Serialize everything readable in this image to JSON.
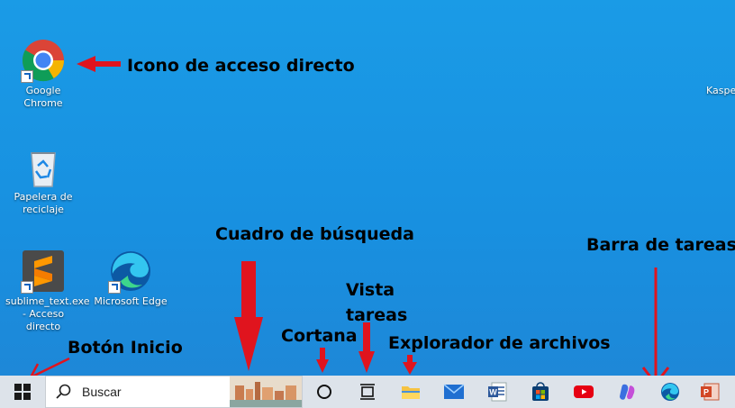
{
  "desktop": {
    "icons": [
      {
        "label": "Google Chrome"
      },
      {
        "label": "Papelera de reciclaje"
      },
      {
        "label": "sublime_text.exe - Acceso directo"
      },
      {
        "label": "Microsoft Edge"
      },
      {
        "label": "Kaspe"
      }
    ]
  },
  "annotations": {
    "shortcut_icon": "Icono de acceso directo",
    "search_box": "Cuadro de búsqueda",
    "taskbar": "Barra de tareas",
    "task_view_line1": "Vista",
    "task_view_line2": "tareas",
    "cortana": "Cortana",
    "start_button": "Botón Inicio",
    "file_explorer": "Explorador de archivos",
    "arrow_color": "#e0141e"
  },
  "taskbar": {
    "search_placeholder": "Buscar",
    "apps": [
      "start-icon",
      "search-icon",
      "cortana-icon",
      "task-view-icon",
      "file-explorer-icon",
      "mail-icon",
      "word-icon",
      "store-icon",
      "youtube-icon",
      "copilot-icon",
      "edge-icon",
      "powerpoint-icon"
    ]
  }
}
